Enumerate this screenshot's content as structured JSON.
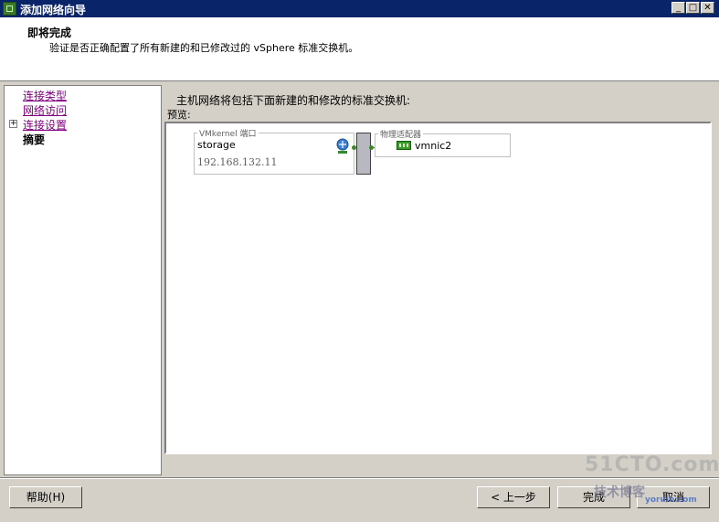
{
  "window": {
    "title": "添加网络向导"
  },
  "header": {
    "title": "即将完成",
    "subtitle": "验证是否正确配置了所有新建的和已修改过的 vSphere 标准交换机。"
  },
  "nav": {
    "items": [
      {
        "label": "连接类型"
      },
      {
        "label": "网络访问"
      },
      {
        "label": "连接设置"
      },
      {
        "label": "摘要"
      }
    ]
  },
  "main": {
    "heading": "主机网络将包括下面新建的和修改的标准交换机:",
    "preview_label": "预览:",
    "vmkernel_group_label": "VMkernel 端口",
    "port_name": "storage",
    "port_ip": "192.168.132.11",
    "adapter_group_label": "物理适配器",
    "adapter_name": "vmnic2"
  },
  "buttons": {
    "help": "帮助(H)",
    "back": "< 上一步",
    "finish": "完成",
    "cancel": "取消"
  },
  "watermark": {
    "site": "51CTO.com",
    "slogan": "技术博客",
    "url": "yoruin.com"
  }
}
